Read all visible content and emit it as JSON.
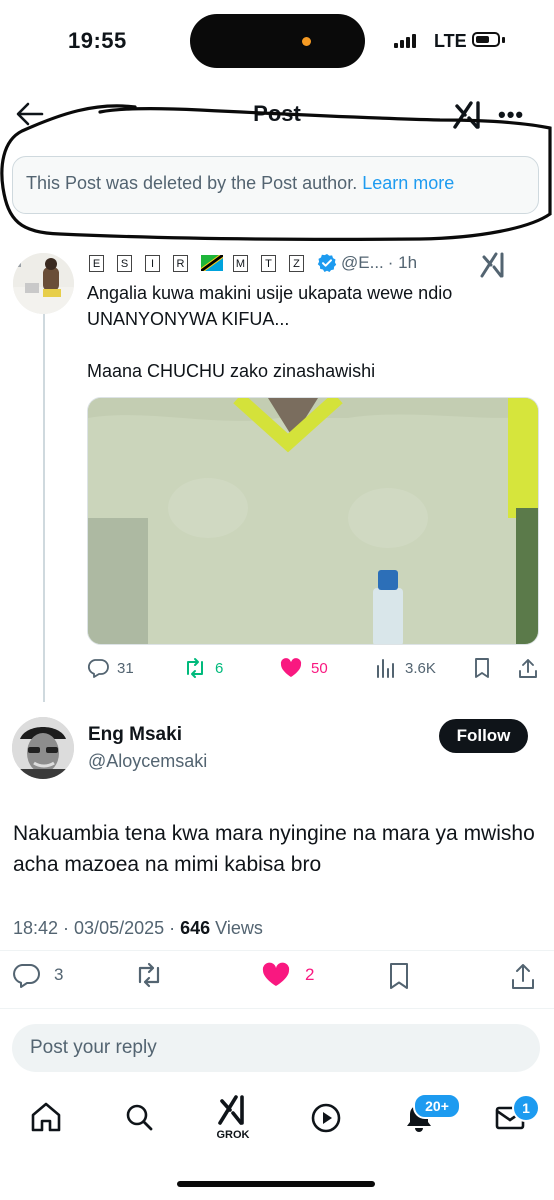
{
  "status_bar": {
    "time": "19:55",
    "network": "LTE"
  },
  "header": {
    "title": "Post"
  },
  "deleted_notice": {
    "text": "This Post was deleted by the Post author.",
    "link": "Learn more"
  },
  "reply_post": {
    "name_letters": [
      "E",
      "S",
      "I",
      "R",
      "M",
      "T",
      "Z"
    ],
    "handle": "@E...",
    "time": "· 1h",
    "text_line1": "Angalia kuwa makini usije ukapata wewe ndio",
    "text_line2": "UNANYONYWA KIFUA...",
    "text_line3": "Maana CHUCHU zako zinashawishi",
    "stats": {
      "replies": "31",
      "reposts": "6",
      "likes": "50",
      "views": "3.6K"
    }
  },
  "main_post": {
    "name": "Eng Msaki",
    "handle": "@Aloycemsaki",
    "follow_label": "Follow",
    "text": "Nakuambia tena kwa mara nyingine na mara ya mwisho  acha mazoea na mimi kabisa bro",
    "datetime": "18:42 · 03/05/2025 · ",
    "views_count": "646",
    "views_label": " Views",
    "stats": {
      "replies": "3",
      "likes": "2"
    }
  },
  "reply_input": {
    "placeholder": "Post your reply"
  },
  "bottom_nav": {
    "grok_label": "GROK",
    "notifications_badge": "20+",
    "messages_badge": "1"
  },
  "colors": {
    "accent": "#1d9bf0",
    "like": "#f91880",
    "repost": "#00ba7c",
    "text": "#0f1419",
    "muted": "#536471"
  }
}
